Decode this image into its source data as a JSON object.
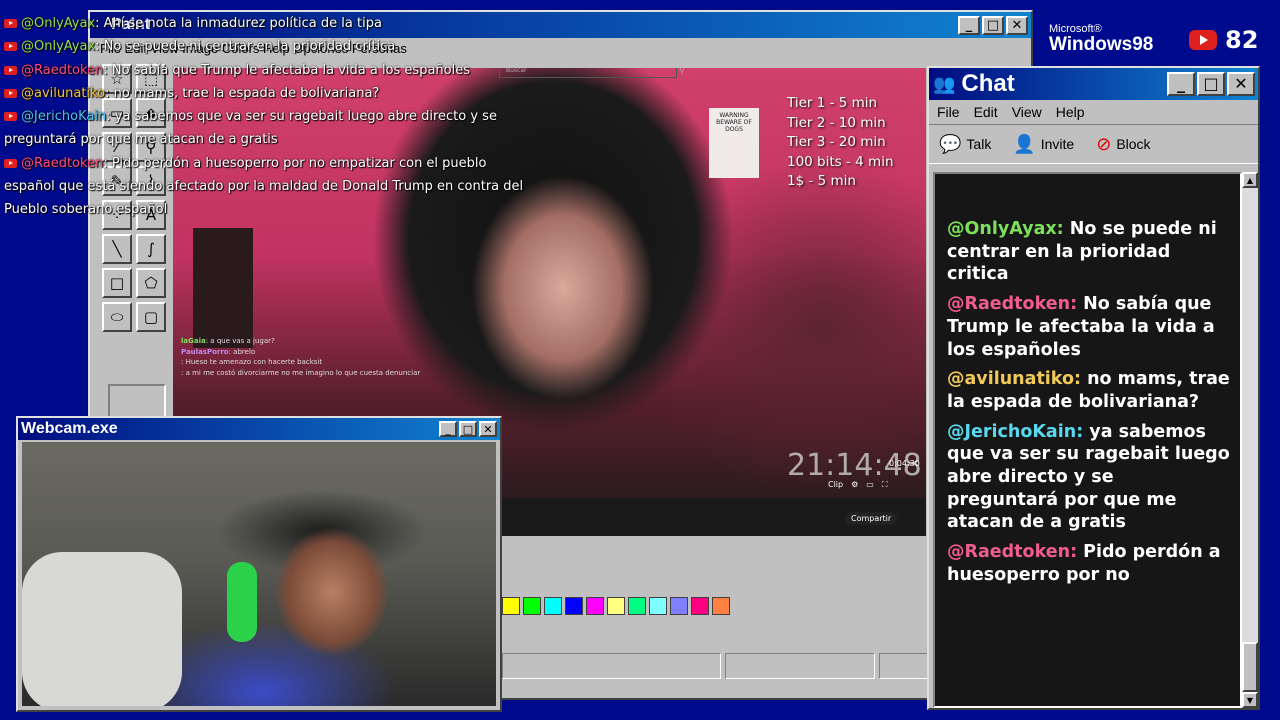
{
  "overlay_chat": [
    {
      "user": "@OnlyAyax",
      "color": "#8ee04a",
      "text": ": Ahí se nota la inmadurez política de la tipa"
    },
    {
      "user": "@OnlyAyax",
      "color": "#8ee04a",
      "text": ": No se puede ni centrar en la prioridad crítica"
    },
    {
      "user": "@Raedtoken",
      "color": "#ff4a7a",
      "text": ": No sabía que Trump le afectaba la vida a los españoles"
    },
    {
      "user": "@avilunatiko",
      "color": "#f1c23a",
      "text": ": no mams, trae la espada de bolivariana?"
    },
    {
      "user": "@JerichoKain",
      "color": "#4ec0f0",
      "text": ": ya sabemos que va ser su ragebait luego abre directo y se preguntará por que me atacan de a gratis"
    },
    {
      "user": "@Raedtoken",
      "color": "#ff4a7a",
      "text": ": Pido perdón a huesoperro por no empatizar con el pueblo español que está siendo afectado por la maldad de Donald Trump en contra del Pueblo soberano español"
    }
  ],
  "paint": {
    "title": "Paint",
    "menu": "File  Edit  View  Image  Colors  Help  Opciones  Personas",
    "tools": [
      "select-star",
      "select-rect",
      "eraser",
      "fill",
      "eyedropper",
      "zoom",
      "pencil",
      "brush",
      "airbrush",
      "text",
      "line",
      "curve",
      "rect",
      "polygon",
      "ellipse",
      "rounded-rect"
    ],
    "palette": [
      "#ffff00",
      "#00ff00",
      "#00ffff",
      "#0000ff",
      "#ff00ff",
      "#ffff80",
      "#00ff80",
      "#80ffff",
      "#8080ff",
      "#ff0080",
      "#ff8040"
    ]
  },
  "video": {
    "search_placeholder": "Buscar",
    "tiers": [
      "Tier 1 - 5 min",
      "Tier 2 - 10 min",
      "Tier 3 - 20 min",
      "100 bits - 4 min",
      "1$ - 5 min"
    ],
    "clock": "21:14:48",
    "timestamp": "0:04:30",
    "clip_label": "Clip",
    "share_label": "Compartir",
    "warning_text": "WARNING BEWARE OF DOGS",
    "inner_chat": [
      {
        "user": "laGaia",
        "text": ": a que vas a jugar?"
      },
      {
        "user": "PaulasPorro",
        "text": ": abrelo"
      },
      {
        "user": "",
        "text": ": Hueso te amenazo con hacerte backsit"
      },
      {
        "user": "",
        "text": ": a mi me costó divorciarme no me imagino lo que cuesta denunciar"
      }
    ]
  },
  "chat": {
    "title": "Chat",
    "menu": [
      "File",
      "Edit",
      "View",
      "Help"
    ],
    "toolbar": [
      {
        "label": "Talk",
        "icon": "talk-icon"
      },
      {
        "label": "Invite",
        "icon": "invite-icon"
      },
      {
        "label": "Block",
        "icon": "block-icon"
      }
    ],
    "messages": [
      {
        "user": "@OnlyAyax:",
        "color": "#7ee05a",
        "text": " No se puede ni centrar en la prioridad critica"
      },
      {
        "user": "@Raedtoken:",
        "color": "#f25d8f",
        "text": " No sabía que Trump le afectaba la vida a los españoles"
      },
      {
        "user": "@avilunatiko:",
        "color": "#f1c85a",
        "text": " no mams, trae la espada de bolivariana?"
      },
      {
        "user": "@JerichoKain:",
        "color": "#59d8f0",
        "text": " ya sabemos que va ser su ragebait luego abre directo y se preguntará por que me atacan de a gratis"
      },
      {
        "user": "@Raedtoken:",
        "color": "#f25d8f",
        "text": " Pido perdón a huesoperro por no"
      }
    ]
  },
  "webcam": {
    "title": "Webcam.exe"
  },
  "branding": {
    "microsoft": "Microsoft®",
    "windows": "Windows98",
    "viewer_count": "82"
  }
}
